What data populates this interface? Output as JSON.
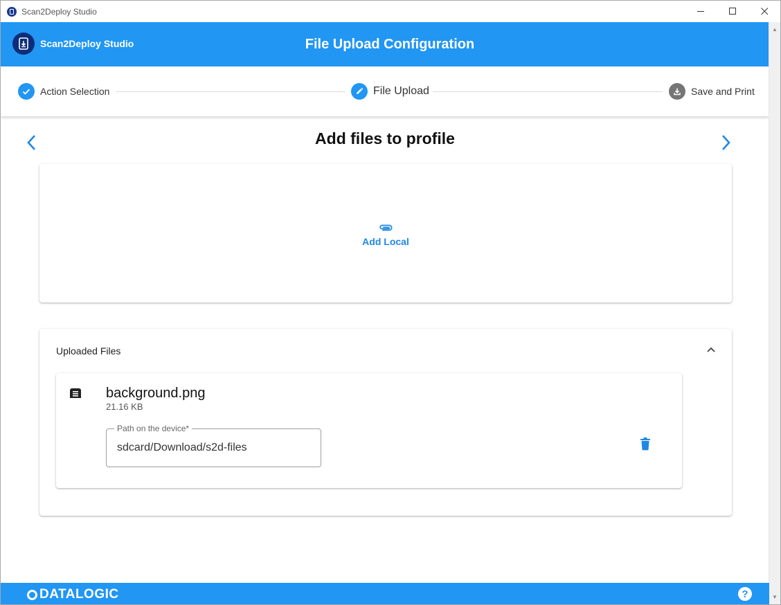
{
  "window": {
    "title": "Scan2Deploy Studio",
    "controls": {
      "minimize": "—",
      "maximize": "☐",
      "close": "✕"
    }
  },
  "header": {
    "brand_name": "Scan2Deploy Studio",
    "page_title": "File Upload Configuration"
  },
  "stepper": {
    "steps": [
      {
        "label": "Action Selection",
        "state": "completed",
        "icon": "check-icon"
      },
      {
        "label": "File Upload",
        "state": "active",
        "icon": "pencil-icon"
      },
      {
        "label": "Save and Print",
        "state": "pending",
        "icon": "download-icon"
      }
    ]
  },
  "main": {
    "heading": "Add files to profile",
    "add_local_label": "Add Local",
    "uploaded_section_title": "Uploaded Files",
    "files": [
      {
        "name": "background.png",
        "size": "21.16 KB",
        "path_label": "Path on the device*",
        "path_value": "sdcard/Download/s2d-files"
      }
    ]
  },
  "footer": {
    "logo_text": "DATALOGIC",
    "help_label": "?"
  },
  "colors": {
    "primary": "#2196f3",
    "brand_dark": "#0d2d7a",
    "pending_step": "#757575"
  }
}
